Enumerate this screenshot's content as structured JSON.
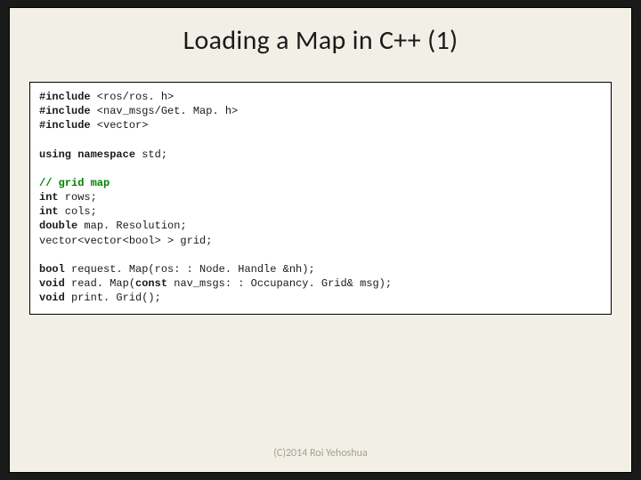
{
  "title": "Loading a Map in C++ (1)",
  "code": {
    "includes": [
      {
        "kw": "#include",
        "rest": " <ros/ros. h>"
      },
      {
        "kw": "#include",
        "rest": " <nav_msgs/Get. Map. h>"
      },
      {
        "kw": "#include",
        "rest": " <vector>"
      }
    ],
    "using_kw": "using namespace",
    "using_rest": " std;",
    "comment": "// grid map",
    "decls": [
      {
        "kw": "int",
        "rest": " rows;"
      },
      {
        "kw": "int",
        "rest": " cols;"
      },
      {
        "kw": "double",
        "rest": " map. Resolution;"
      },
      {
        "kw": "",
        "rest": "vector<vector<bool> > grid;"
      }
    ],
    "protos": [
      {
        "kw": "bool",
        "rest": " request. Map(ros: : Node. Handle &nh);"
      },
      {
        "kw": "void",
        "mid": " read. Map(",
        "kw2": "const",
        "rest2": " nav_msgs: : Occupancy. Grid& msg);"
      },
      {
        "kw": "void",
        "rest": " print. Grid();"
      }
    ]
  },
  "footer": "(C)2014 Roi Yehoshua"
}
